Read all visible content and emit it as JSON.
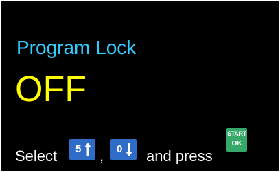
{
  "colors": {
    "background": "#000000",
    "title": "#33ccff",
    "state": "#ffff00",
    "instruction_text": "#ffffff",
    "key_blue": "#2f6cc7",
    "key_green": "#36a96a",
    "key_symbol": "#ffffff"
  },
  "screen": {
    "title": "Program Lock",
    "state": "OFF"
  },
  "instruction": {
    "prefix": "Select",
    "separator": ",",
    "suffix": "and press"
  },
  "keys": {
    "up": {
      "digit": "5",
      "icon": "arrow-up-icon"
    },
    "down": {
      "digit": "0",
      "icon": "arrow-down-icon"
    },
    "start_ok": {
      "top_label": "START",
      "bottom_label": "OK"
    }
  }
}
